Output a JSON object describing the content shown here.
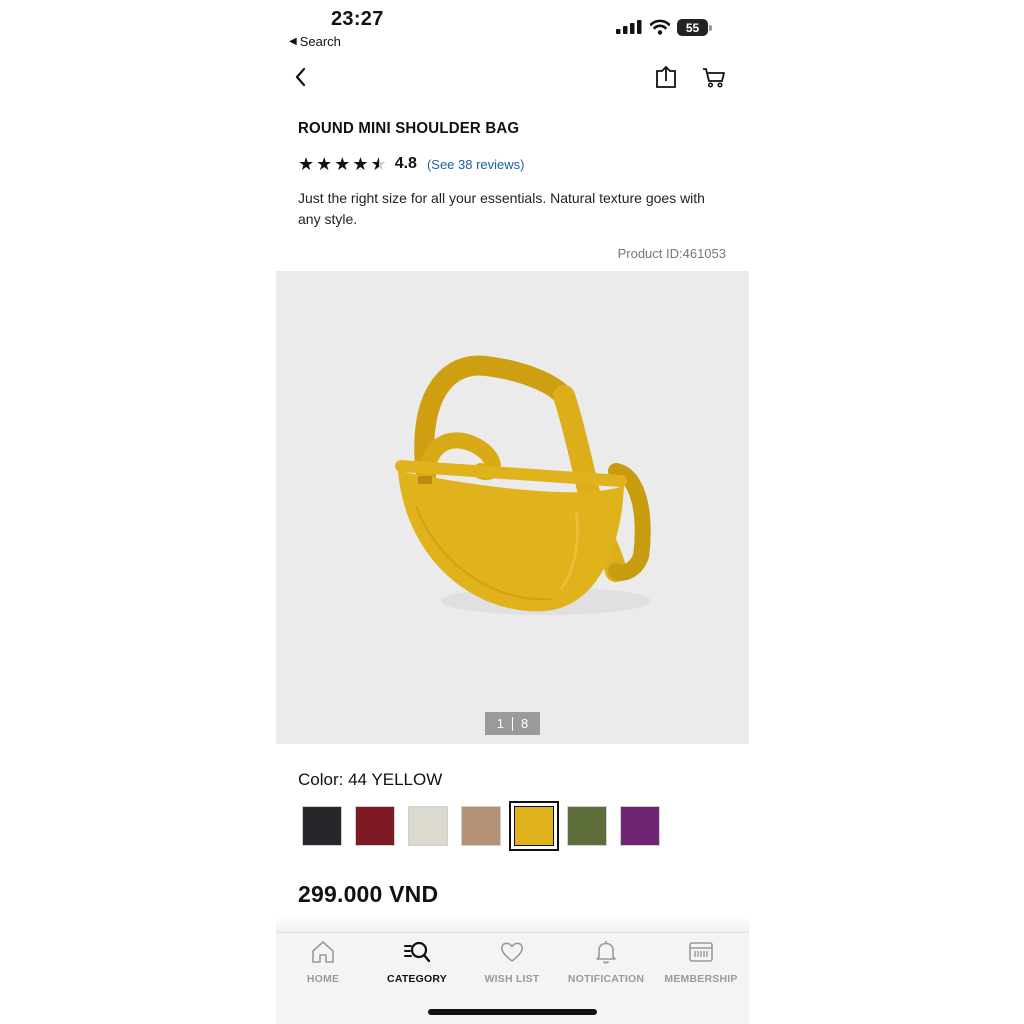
{
  "status_bar": {
    "time": "23:27",
    "back_label": "Search",
    "battery": "55"
  },
  "product": {
    "title": "ROUND MINI SHOULDER BAG",
    "rating": 4.5,
    "rating_text": "4.8",
    "reviews_link": "(See 38 reviews)",
    "description": "Just the right size for all your essentials. Natural texture goes with any style.",
    "product_id": "Product ID:461053"
  },
  "gallery": {
    "current": "1",
    "total": "8"
  },
  "color": {
    "label": "Color: 44 YELLOW",
    "swatches": [
      {
        "name": "black",
        "hex": "#26272b"
      },
      {
        "name": "wine",
        "hex": "#7e1a22"
      },
      {
        "name": "off-white",
        "hex": "#dcd9cf"
      },
      {
        "name": "beige",
        "hex": "#b39277"
      },
      {
        "name": "yellow",
        "hex": "#e0b21c",
        "selected": true
      },
      {
        "name": "olive",
        "hex": "#5e6e3a"
      },
      {
        "name": "purple",
        "hex": "#6f2472"
      }
    ]
  },
  "price": "299.000 VND",
  "tabbar": {
    "items": [
      {
        "label": "HOME",
        "icon": "home-icon",
        "active": false
      },
      {
        "label": "CATEGORY",
        "icon": "category-search-icon",
        "active": true
      },
      {
        "label": "WISH LIST",
        "icon": "heart-icon",
        "active": false
      },
      {
        "label": "NOTIFICATION",
        "icon": "bell-icon",
        "active": false
      },
      {
        "label": "MEMBERSHIP",
        "icon": "membership-card-icon",
        "active": false
      }
    ]
  },
  "colors": {
    "accent_link": "#1b5fa8",
    "image_bg": "#ebebeb",
    "bag": "#e0b21c"
  }
}
